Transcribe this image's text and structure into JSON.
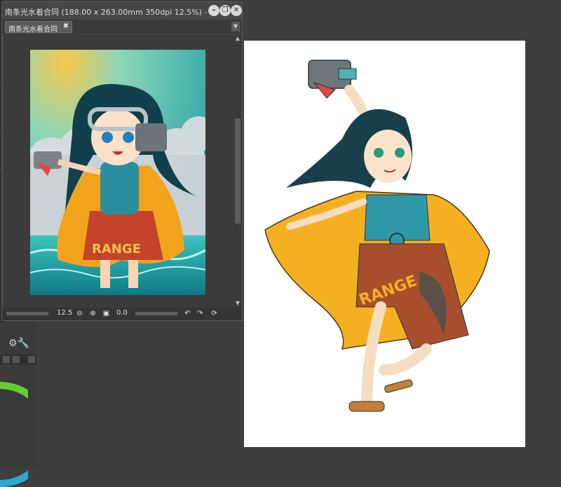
{
  "document": {
    "window_title": "南条光水着合同 (188.00 x 263.00mm 350dpi 12.5%)",
    "window_title_suffix": "- (",
    "tab_label": "南条光水着合同",
    "tab_close": "✖"
  },
  "window_controls": {
    "minimize": "–",
    "restore": "❐",
    "close": "✕"
  },
  "statusbar": {
    "zoom": "12.5",
    "rotation": "0.0",
    "zoom_out_icon": "zoom-out-icon",
    "zoom_in_icon": "zoom-in-icon",
    "fit_icon": "fit-window-icon",
    "rotate_left_icon": "rotate-left-icon",
    "rotate_right_icon": "rotate-right-icon",
    "reset_rotation_icon": "reset-rotation-icon"
  },
  "colors": {
    "app_background": "#3e3e3e",
    "panel_background": "#474747",
    "canvas_white": "#ffffff",
    "accent_orange": "#f0a020",
    "accent_teal": "#2fa6a8"
  }
}
